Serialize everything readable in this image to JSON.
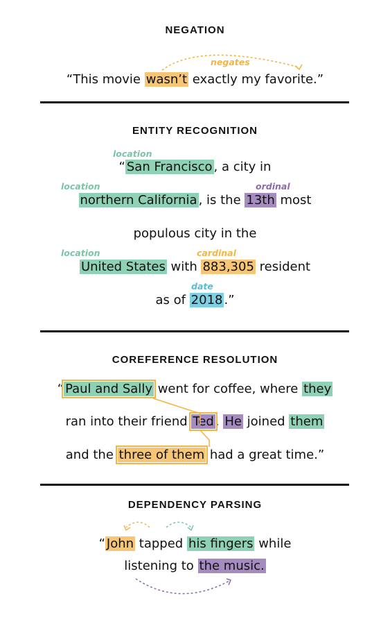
{
  "negation": {
    "title": "NEGATION",
    "tag": "negates",
    "pre": "“This movie ",
    "highlight": "wasn’t",
    "post": " exactly my favorite.”"
  },
  "entity": {
    "title": "ENTITY RECOGNITION",
    "tags": {
      "location": "location",
      "ordinal": "ordinal",
      "cardinal": "cardinal",
      "date": "date"
    },
    "l1_pre": "“",
    "l1_hl": "San Francisco",
    "l1_post": ", a city in",
    "l2_hl1": "northern California",
    "l2_mid": ", is the ",
    "l2_hl2": "13th",
    "l2_post": " most",
    "l3": "populous city in the",
    "l4_hl1": "United States",
    "l4_mid": " with ",
    "l4_hl2": "883,305",
    "l4_post": " resident",
    "l5_pre": "as of ",
    "l5_hl": "2018",
    "l5_post": ".”"
  },
  "coref": {
    "title": "COREFERENCE RESOLUTION",
    "l1_pre": "“",
    "l1_hl1": "Paul and Sally",
    "l1_mid": " went for coffee, where ",
    "l1_hl2": "they",
    "l2_pre": "ran into their friend ",
    "l2_hl1": "Ted",
    "l2_mid1": ". ",
    "l2_hl2": "He",
    "l2_mid2": " joined ",
    "l2_hl3": "them",
    "l3_pre": "and the ",
    "l3_hl": "three of them",
    "l3_post": " had a great time.”"
  },
  "dependency": {
    "title": "DEPENDENCY PARSING",
    "l1_pre": "“",
    "l1_hl1": "John",
    "l1_mid": " tapped ",
    "l1_hl2": "his fingers",
    "l1_post": " while",
    "l2_pre": "listening to ",
    "l2_hl": "the music."
  },
  "colors": {
    "teal": "#8fd1b5",
    "orange": "#f7c576",
    "purple": "#a58bc0",
    "blue": "#7fcfe3",
    "orange_stroke": "#f2b647",
    "purple_stroke": "#8d6aa9",
    "teal_stroke": "#7cc4a6"
  }
}
